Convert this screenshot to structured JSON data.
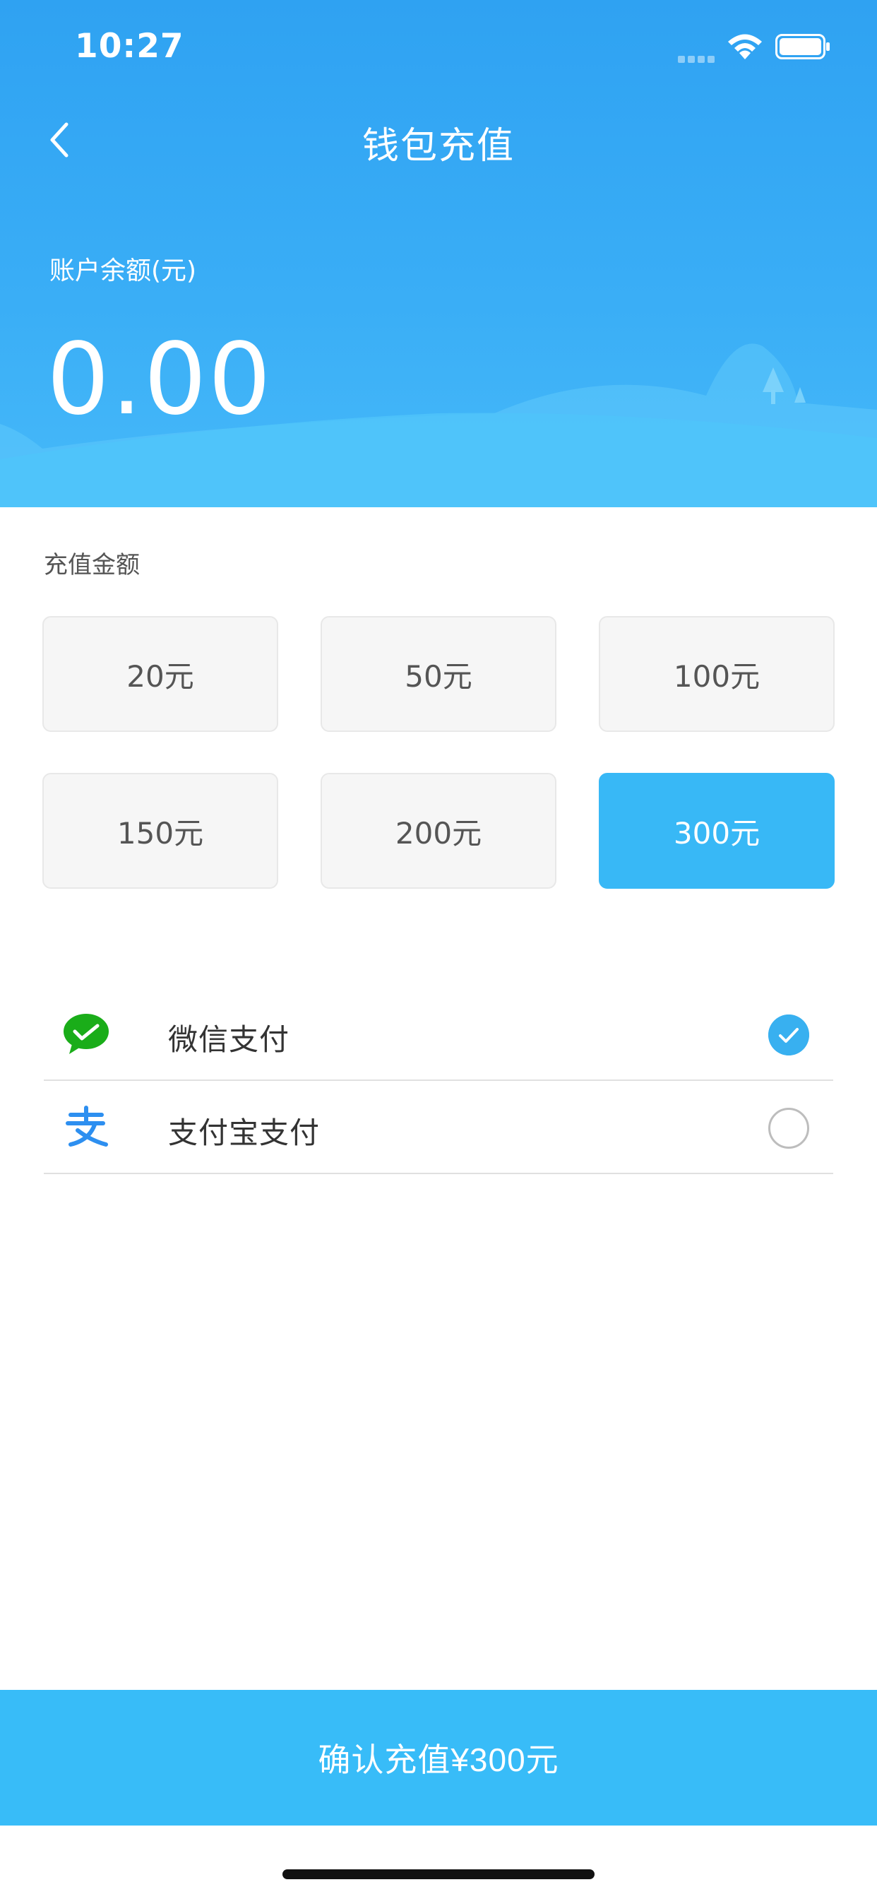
{
  "status_bar": {
    "time": "10:27"
  },
  "nav": {
    "title": "钱包充值",
    "back_icon": "chevron-left-icon"
  },
  "balance": {
    "label": "账户余额(元)",
    "value": "0.00"
  },
  "amount_section": {
    "label": "充值金额",
    "options": [
      {
        "label": "20元",
        "selected": false
      },
      {
        "label": "50元",
        "selected": false
      },
      {
        "label": "100元",
        "selected": false
      },
      {
        "label": "150元",
        "selected": false
      },
      {
        "label": "200元",
        "selected": false
      },
      {
        "label": "300元",
        "selected": true
      }
    ]
  },
  "payment_methods": [
    {
      "label": "微信支付",
      "icon": "wechat-pay-icon",
      "checked": true
    },
    {
      "label": "支付宝支付",
      "icon": "alipay-icon",
      "checked": false
    }
  ],
  "confirm": {
    "label": "确认充值¥300元"
  },
  "colors": {
    "header_blue": "#2fa2f2",
    "accent_blue": "#38b8f6",
    "wechat_green": "#1aad19",
    "alipay_blue": "#2d8ff0"
  }
}
